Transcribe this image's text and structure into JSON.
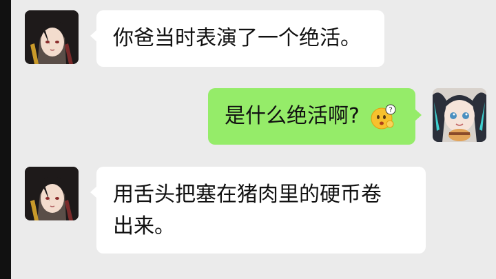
{
  "colors": {
    "chat_background": "#ebebeb",
    "incoming_bubble": "#ffffff",
    "outgoing_bubble": "#95ec69",
    "text": "#111111"
  },
  "messages": [
    {
      "side": "left",
      "sender_avatar": "anime-girl-dark-hair-avatar",
      "text": "你爸当时表演了一个绝活。"
    },
    {
      "side": "right",
      "sender_avatar": "anime-girl-teal-twintails-avatar",
      "text": "是什么绝活啊?",
      "emoji": "thinking-face-with-question-mark-emoji"
    },
    {
      "side": "left",
      "sender_avatar": "anime-girl-dark-hair-avatar",
      "text_lines": [
        "用舌头把塞在猪肉里的硬币卷",
        "出来。"
      ]
    }
  ]
}
